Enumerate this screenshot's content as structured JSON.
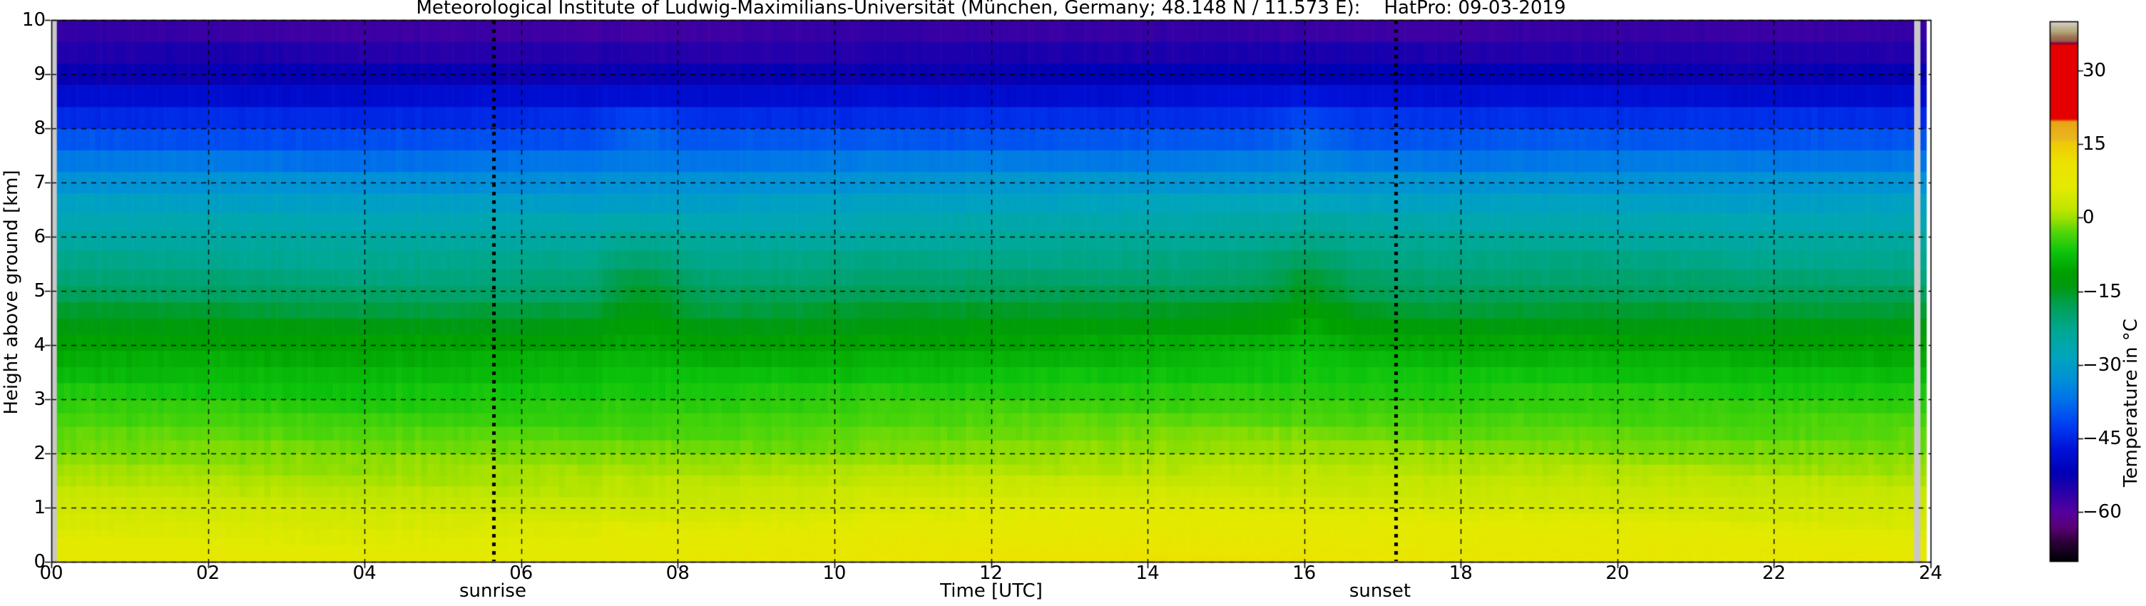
{
  "title": "Meteorological Institute of Ludwig-Maximilians-Universität (München, Germany; 48.148 N / 11.573 E):    HatPro: 09-03-2019",
  "axes": {
    "x": {
      "label": "Time [UTC]",
      "min_hour": 0,
      "max_hour": 24,
      "tick_hours": [
        0,
        2,
        4,
        6,
        8,
        10,
        12,
        14,
        16,
        18,
        20,
        22,
        24
      ],
      "tick_labels": [
        "00",
        "02",
        "04",
        "06",
        "08",
        "10",
        "12",
        "14",
        "16",
        "18",
        "20",
        "22",
        "24"
      ]
    },
    "y": {
      "label": "Height above ground [km]",
      "min_km": 0,
      "max_km": 10,
      "tick_km": [
        0,
        1,
        2,
        3,
        4,
        5,
        6,
        7,
        8,
        9,
        10
      ],
      "tick_labels": [
        "0",
        "1",
        "2",
        "3",
        "4",
        "5",
        "6",
        "7",
        "8",
        "9",
        "10"
      ]
    }
  },
  "annotations": {
    "sunrise": {
      "label": "sunrise",
      "time_utc_hours": 5.65
    },
    "sunset": {
      "label": "sunset",
      "time_utc_hours": 17.17
    }
  },
  "colorbar": {
    "label": "Temperature in °C",
    "min_c": -70,
    "max_c": 40,
    "tick_values_c": [
      30,
      15,
      0,
      -15,
      -30,
      -45,
      -60
    ],
    "tick_labels": [
      "30",
      "15",
      "0",
      "−15",
      "−30",
      "−45",
      "−60"
    ]
  },
  "chart_data": {
    "type": "heatmap",
    "title": "Meteorological Institute of Ludwig-Maximilians-Universität (München, Germany; 48.148 N / 11.573 E):    HatPro: 09-03-2019",
    "xlabel": "Time [UTC]",
    "ylabel": "Height above ground [km]",
    "value_label": "Temperature in °C",
    "x_range_hours": [
      0,
      24
    ],
    "y_range_km": [
      0,
      10
    ],
    "value_range_c": [
      -70,
      40
    ],
    "grid": {
      "x_step_hours": 2,
      "y_step_km": 1,
      "style": "dashed-black"
    },
    "column_width_hours": 0.08,
    "profiles": {
      "heights_km": [
        0,
        1,
        2,
        3,
        4,
        5,
        6,
        7,
        8,
        9,
        10
      ],
      "times_hours": [
        0,
        6,
        9,
        12,
        14,
        16,
        18,
        21,
        24
      ],
      "temps_c": [
        [
          8.0,
          3.5,
          -1.0,
          -5.5,
          -10.5,
          -19.0,
          -24.5,
          -32.5,
          -42.0,
          -52.5,
          -58.5
        ],
        [
          7.5,
          3.0,
          -1.5,
          -6.0,
          -11.0,
          -19.5,
          -25.0,
          -33.0,
          -42.5,
          -53.0,
          -59.0
        ],
        [
          9.5,
          4.0,
          -1.0,
          -5.5,
          -10.5,
          -19.0,
          -24.5,
          -32.5,
          -42.0,
          -52.5,
          -58.5
        ],
        [
          11.0,
          5.0,
          -0.5,
          -5.0,
          -10.0,
          -18.5,
          -24.0,
          -32.0,
          -42.0,
          -52.5,
          -58.5
        ],
        [
          11.5,
          5.5,
          0.0,
          -4.5,
          -9.5,
          -18.0,
          -23.5,
          -32.0,
          -41.5,
          -52.0,
          -58.5
        ],
        [
          11.0,
          5.0,
          0.0,
          -4.5,
          -9.5,
          -18.0,
          -23.5,
          -31.5,
          -41.5,
          -52.0,
          -58.5
        ],
        [
          10.0,
          4.5,
          -0.5,
          -5.0,
          -10.0,
          -18.5,
          -24.0,
          -32.0,
          -42.0,
          -52.0,
          -58.5
        ],
        [
          9.0,
          4.0,
          -1.0,
          -5.5,
          -10.5,
          -19.0,
          -24.5,
          -32.5,
          -42.0,
          -52.5,
          -58.5
        ],
        [
          8.5,
          3.5,
          -1.0,
          -5.5,
          -10.5,
          -19.0,
          -24.5,
          -32.5,
          -42.0,
          -52.5,
          -58.5
        ]
      ]
    },
    "warm_anomalies": [
      {
        "t_hours": 7.55,
        "sigma_t": 0.5,
        "h_km": 5.0,
        "sigma_h": 1.0,
        "amp_c": 3.8
      },
      {
        "t_hours": 7.55,
        "sigma_t": 0.4,
        "h_km": 7.9,
        "sigma_h": 0.55,
        "amp_c": 2.5
      },
      {
        "t_hours": 16.05,
        "sigma_t": 0.55,
        "h_km": 5.0,
        "sigma_h": 1.0,
        "amp_c": 3.5
      },
      {
        "t_hours": 16.05,
        "sigma_t": 0.45,
        "h_km": 7.9,
        "sigma_h": 0.55,
        "amp_c": 2.5
      }
    ],
    "missing_data_columns": [
      {
        "t0_hours": 0.0,
        "t1_hours": 0.07,
        "color": "#c8c8c8"
      },
      {
        "t0_hours": 23.79,
        "t1_hours": 23.87,
        "color": "#c8c8c8"
      },
      {
        "t0_hours": 23.95,
        "t1_hours": 24.0,
        "color": "#ffffff"
      }
    ],
    "level_edges_km": [
      0,
      0.1,
      0.2,
      0.3,
      0.45,
      0.6,
      0.75,
      0.9,
      1.05,
      1.2,
      1.4,
      1.6,
      1.8,
      2.0,
      2.25,
      2.5,
      2.75,
      3.0,
      3.3,
      3.6,
      3.9,
      4.2,
      4.5,
      4.8,
      5.1,
      5.4,
      5.75,
      6.1,
      6.45,
      6.8,
      7.2,
      7.6,
      8.0,
      8.4,
      8.8,
      9.2,
      9.6,
      10.0
    ],
    "colormap_stops": [
      [
        40.0,
        "#d8d4d2"
      ],
      [
        38.8,
        "#beb694"
      ],
      [
        38.0,
        "#b4a878"
      ],
      [
        37.0,
        "#a07858"
      ],
      [
        36.0,
        "#96584a"
      ],
      [
        35.6,
        "#7c0038"
      ],
      [
        35.2,
        "#e40000"
      ],
      [
        20.2,
        "#e40000"
      ],
      [
        19.6,
        "#e8a414"
      ],
      [
        16.0,
        "#eab81e"
      ],
      [
        15.4,
        "#eec80a"
      ],
      [
        11.0,
        "#ece400"
      ],
      [
        6.0,
        "#e2ea00"
      ],
      [
        2.0,
        "#c2e600"
      ],
      [
        0.0,
        "#9ee000"
      ],
      [
        -3.0,
        "#50d60a"
      ],
      [
        -7.0,
        "#0cc40c"
      ],
      [
        -11.0,
        "#00a000"
      ],
      [
        -14.0,
        "#009a10"
      ],
      [
        -18.0,
        "#00a058"
      ],
      [
        -23.0,
        "#00a894"
      ],
      [
        -28.0,
        "#00a6ba"
      ],
      [
        -33.0,
        "#0090d8"
      ],
      [
        -37.0,
        "#0072ea"
      ],
      [
        -42.0,
        "#0040f2"
      ],
      [
        -47.0,
        "#0012da"
      ],
      [
        -52.0,
        "#0000b4"
      ],
      [
        -56.0,
        "#2b00a8"
      ],
      [
        -60.0,
        "#54009e"
      ],
      [
        -63.0,
        "#5a0078"
      ],
      [
        -66.0,
        "#2e0038"
      ],
      [
        -68.5,
        "#10001a"
      ],
      [
        -70.0,
        "#000000"
      ]
    ],
    "sun_lines": {
      "sunrise_hour": 5.65,
      "sunset_hour": 17.17,
      "style": "bold-dotted-black"
    }
  }
}
